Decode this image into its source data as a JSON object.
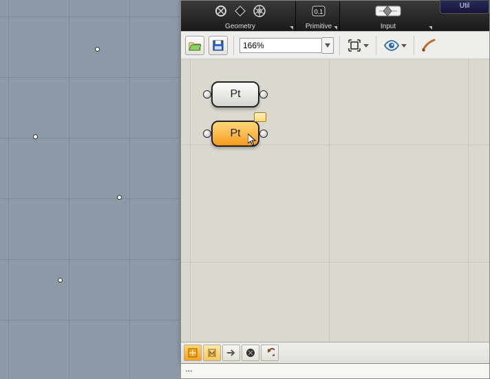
{
  "ribbon": {
    "geometry_label": "Geometry",
    "primitive_label": "Primitive",
    "input_label": "Input",
    "util_tab_label": "Util"
  },
  "toolbar": {
    "zoom_value": "166%"
  },
  "canvas": {
    "node1_label": "Pt",
    "node2_label": "Pt"
  },
  "status": {
    "text": "…"
  }
}
